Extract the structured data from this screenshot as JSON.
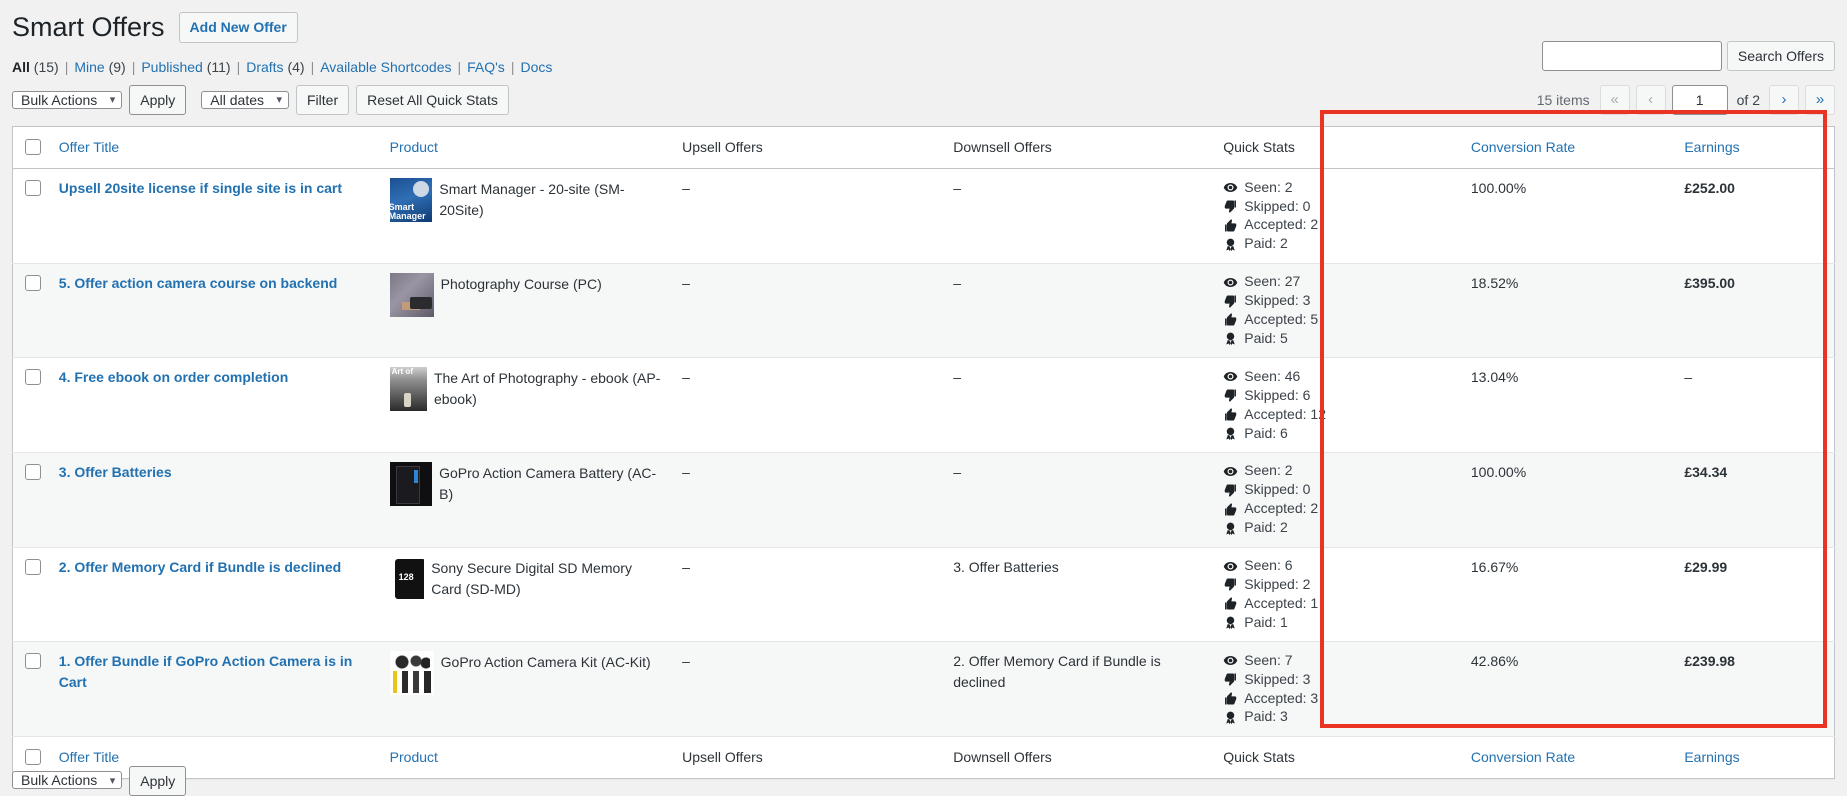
{
  "header": {
    "title": "Smart Offers",
    "add_new_label": "Add New Offer"
  },
  "status_links": [
    {
      "label": "All",
      "count": "(15)",
      "current": true
    },
    {
      "label": "Mine",
      "count": "(9)",
      "current": false
    },
    {
      "label": "Published",
      "count": "(11)",
      "current": false
    },
    {
      "label": "Drafts",
      "count": "(4)",
      "current": false
    },
    {
      "label": "Available Shortcodes",
      "count": "",
      "current": false
    },
    {
      "label": "FAQ's",
      "count": "",
      "current": false
    },
    {
      "label": "Docs",
      "count": "",
      "current": false
    }
  ],
  "toolbar": {
    "bulk_actions_label": "Bulk Actions",
    "apply_label": "Apply",
    "dates_label": "All dates",
    "filter_label": "Filter",
    "reset_stats_label": "Reset All Quick Stats"
  },
  "search": {
    "value": "",
    "placeholder": "",
    "button_label": "Search Offers"
  },
  "pagination": {
    "items_label": "15 items",
    "first_label": "«",
    "prev_label": "‹",
    "current_page": "1",
    "of_label": "of 2",
    "next_label": "›",
    "last_label": "»"
  },
  "table": {
    "columns": {
      "offer_title": "Offer Title",
      "product": "Product",
      "upsell": "Upsell Offers",
      "downsell": "Downsell Offers",
      "quick_stats": "Quick Stats",
      "conversion_rate": "Conversion Rate",
      "earnings": "Earnings"
    },
    "stat_labels": {
      "seen": "Seen:",
      "skipped": "Skipped:",
      "accepted": "Accepted:",
      "paid": "Paid:"
    },
    "rows": [
      {
        "title": "Upsell 20site license if single site is in cart",
        "product": "Smart Manager - 20-site (SM-20Site)",
        "thumb_class": "th-smart",
        "upsell": "–",
        "downsell": "–",
        "seen": "2",
        "skipped": "0",
        "accepted": "2",
        "paid": "2",
        "conversion_rate": "100.00%",
        "earnings": "£252.00"
      },
      {
        "title": "5. Offer action camera course on backend",
        "product": "Photography Course (PC)",
        "thumb_class": "th-course",
        "upsell": "–",
        "downsell": "–",
        "seen": "27",
        "skipped": "3",
        "accepted": "5",
        "paid": "5",
        "conversion_rate": "18.52%",
        "earnings": "£395.00"
      },
      {
        "title": "4. Free ebook on order completion",
        "product": "The Art of Photography - ebook (AP-ebook)",
        "thumb_class": "th-ebook",
        "upsell": "–",
        "downsell": "–",
        "seen": "46",
        "skipped": "6",
        "accepted": "12",
        "paid": "6",
        "conversion_rate": "13.04%",
        "earnings": "–"
      },
      {
        "title": "3. Offer Batteries",
        "product": "GoPro Action Camera Battery (AC-B)",
        "thumb_class": "th-batt",
        "upsell": "–",
        "downsell": "–",
        "seen": "2",
        "skipped": "0",
        "accepted": "2",
        "paid": "2",
        "conversion_rate": "100.00%",
        "earnings": "£34.34"
      },
      {
        "title": "2. Offer Memory Card if Bundle is declined",
        "product": "Sony Secure Digital SD Memory Card (SD-MD)",
        "thumb_class": "th-sd",
        "upsell": "–",
        "downsell": "3. Offer Batteries",
        "seen": "6",
        "skipped": "2",
        "accepted": "1",
        "paid": "1",
        "conversion_rate": "16.67%",
        "earnings": "£29.99"
      },
      {
        "title": "1. Offer Bundle if GoPro Action Camera is in Cart",
        "product": "GoPro Action Camera Kit (AC-Kit)",
        "thumb_class": "th-kit",
        "upsell": "–",
        "downsell": "2. Offer Memory Card if Bundle is declined",
        "seen": "7",
        "skipped": "3",
        "accepted": "3",
        "paid": "3",
        "conversion_rate": "42.86%",
        "earnings": "£239.98"
      }
    ]
  },
  "annotation": {
    "highlight_color": "#ea3323"
  }
}
